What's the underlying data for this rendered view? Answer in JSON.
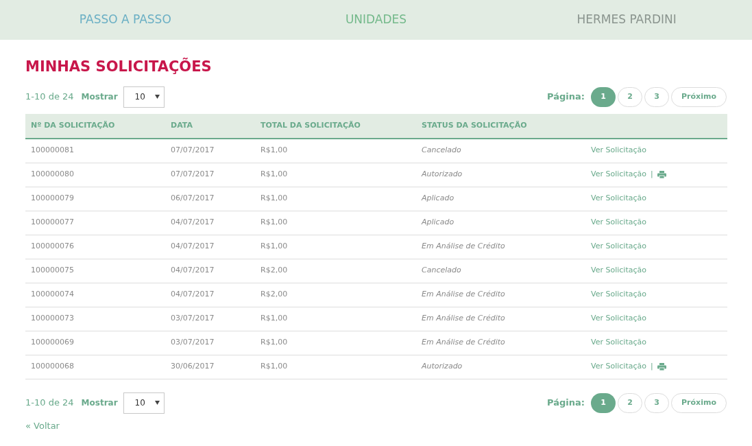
{
  "nav": [
    {
      "label": "PASSO A PASSO",
      "color": "#6aafc4"
    },
    {
      "label": "UNIDADES",
      "color": "#74b98b"
    },
    {
      "label": "HERMES PARDINI",
      "color": "#8a948e"
    }
  ],
  "title": "MINHAS SOLICITAÇÕES",
  "pagers": [
    {
      "range": "1-10 de 24",
      "show_label": "Mostrar",
      "per_page": "10",
      "page_label": "Página:",
      "pages": [
        {
          "label": "1",
          "selected": true
        },
        {
          "label": "2",
          "selected": false
        },
        {
          "label": "3",
          "selected": false
        }
      ],
      "next": "Próximo"
    },
    {
      "range": "1-10 de 24",
      "show_label": "Mostrar",
      "per_page": "10",
      "page_label": "Página:",
      "pages": [
        {
          "label": "1",
          "selected": true
        },
        {
          "label": "2",
          "selected": false
        },
        {
          "label": "3",
          "selected": false
        }
      ],
      "next": "Próximo"
    }
  ],
  "table": {
    "columns": [
      "Nº DA SOLICITAÇÃO",
      "DATA",
      "TOTAL DA SOLICITAÇÃO",
      "STATUS DA SOLICITAÇÃO"
    ],
    "rows": [
      {
        "number": "100000081",
        "date": "07/07/2017",
        "total": "R$1,00",
        "status": "Cancelado",
        "link": "Ver Solicitação",
        "printable": false
      },
      {
        "number": "100000080",
        "date": "07/07/2017",
        "total": "R$1,00",
        "status": "Autorizado",
        "link": "Ver Solicitação",
        "separator": "|",
        "printable": true
      },
      {
        "number": "100000079",
        "date": "06/07/2017",
        "total": "R$1,00",
        "status": "Aplicado",
        "link": "Ver Solicitação",
        "printable": false
      },
      {
        "number": "100000077",
        "date": "04/07/2017",
        "total": "R$1,00",
        "status": "Aplicado",
        "link": "Ver Solicitação",
        "printable": false
      },
      {
        "number": "100000076",
        "date": "04/07/2017",
        "total": "R$1,00",
        "status": "Em Análise de Crédito",
        "link": "Ver Solicitação",
        "printable": false
      },
      {
        "number": "100000075",
        "date": "04/07/2017",
        "total": "R$2,00",
        "status": "Cancelado",
        "link": "Ver Solicitação",
        "printable": false
      },
      {
        "number": "100000074",
        "date": "04/07/2017",
        "total": "R$2,00",
        "status": "Em Análise de Crédito",
        "link": "Ver Solicitação",
        "printable": false
      },
      {
        "number": "100000073",
        "date": "03/07/2017",
        "total": "R$1,00",
        "status": "Em Análise de Crédito",
        "link": "Ver Solicitação",
        "printable": false
      },
      {
        "number": "100000069",
        "date": "03/07/2017",
        "total": "R$1,00",
        "status": "Em Análise de Crédito",
        "link": "Ver Solicitação",
        "printable": false
      },
      {
        "number": "100000068",
        "date": "30/06/2017",
        "total": "R$1,00",
        "status": "Autorizado",
        "link": "Ver Solicitação",
        "separator": "|",
        "printable": true
      }
    ]
  },
  "back_link": "« Voltar"
}
